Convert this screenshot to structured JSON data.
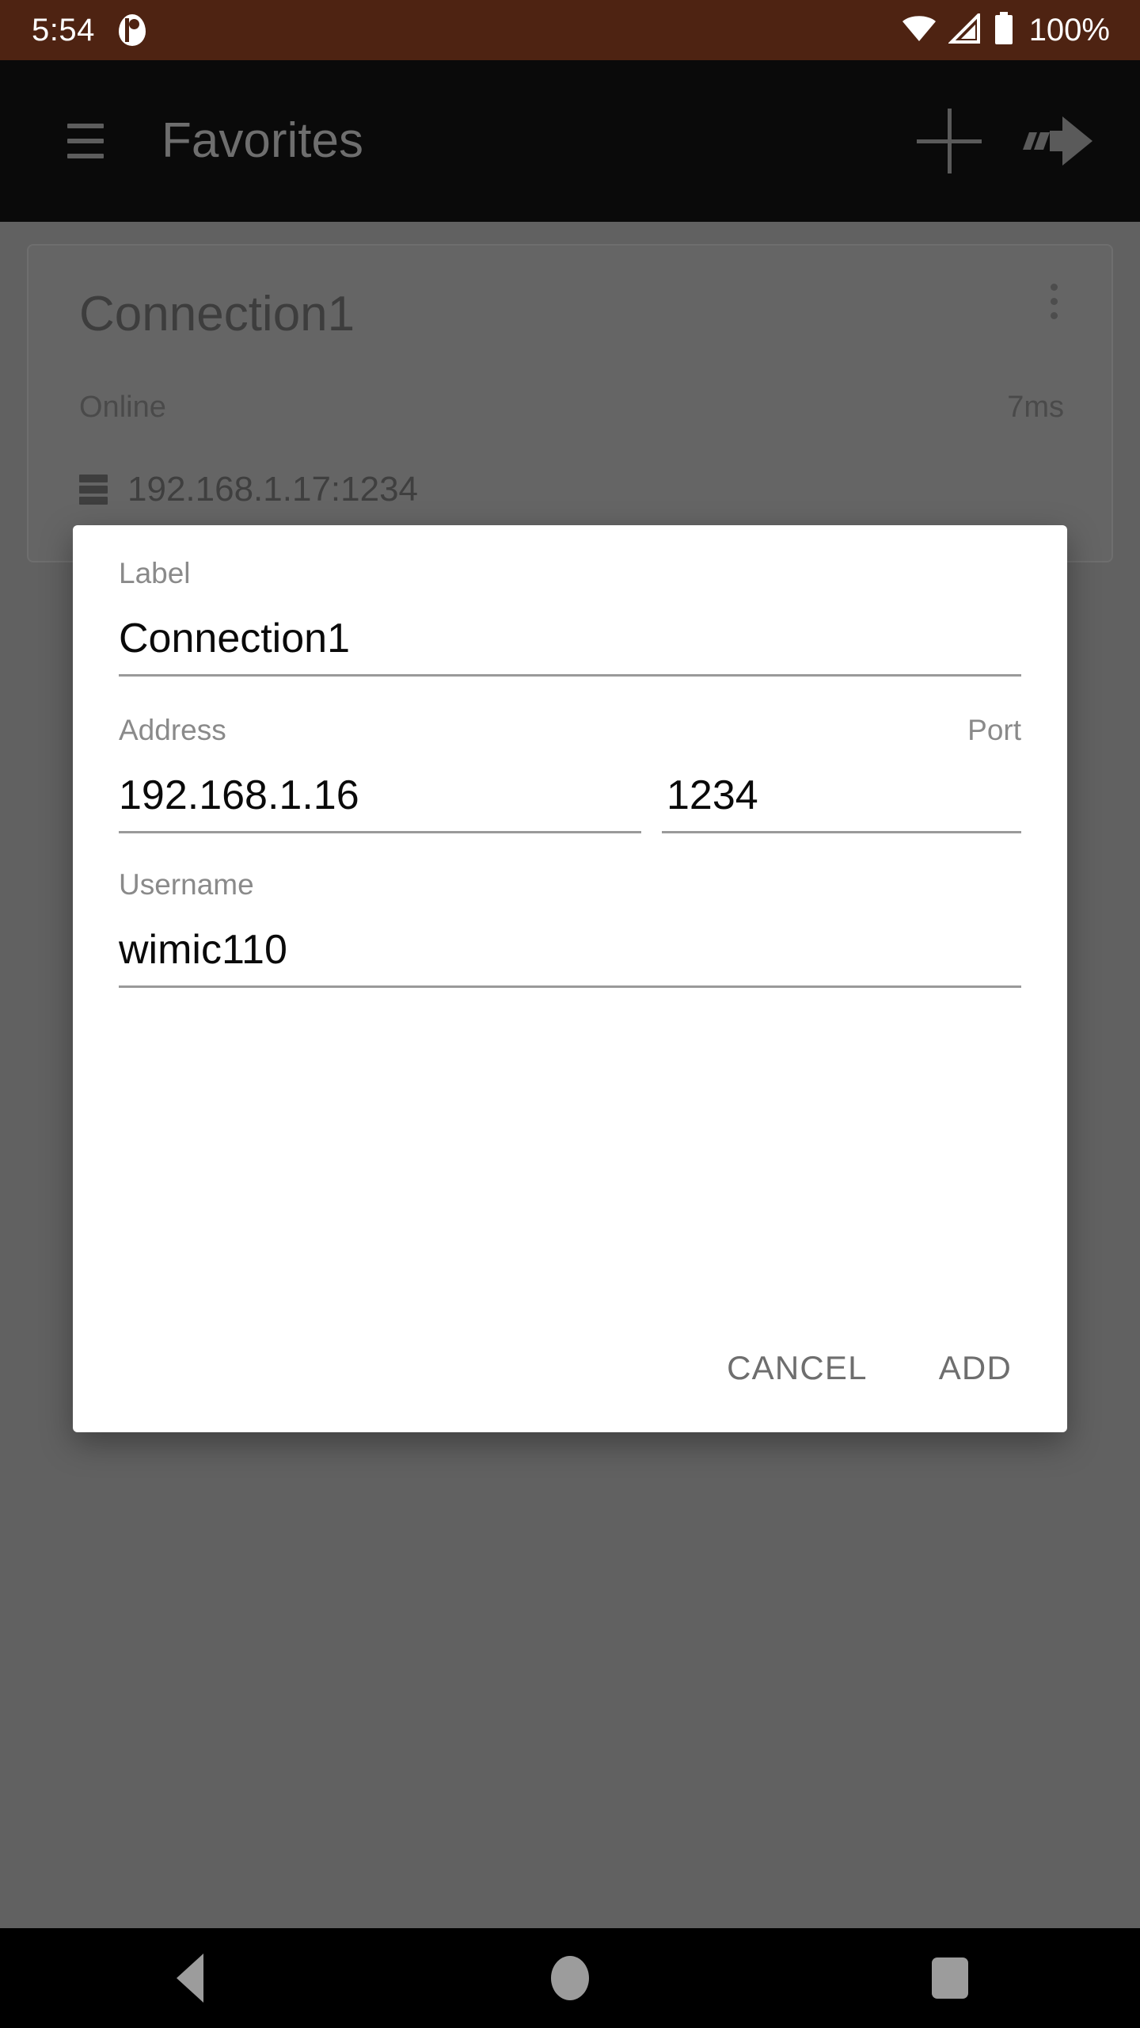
{
  "status_bar": {
    "clock": "5:54",
    "app_icon": "app-notification-icon",
    "wifi_icon": "wifi-icon",
    "cellular_icon": "cellular-signal-icon",
    "battery_icon": "battery-full-icon",
    "battery_text": "100%",
    "background_color": "#4E2312",
    "foreground_color": "#FFFFFF"
  },
  "app_bar": {
    "menu_icon": "hamburger-menu-icon",
    "title": "Favorites",
    "add_icon": "plus-icon",
    "forward_icon": "fast-forward-arrow-icon",
    "background_color": "#0A0A0A",
    "title_color": "#6E6E6E"
  },
  "connection_card": {
    "title": "Connection1",
    "status": "Online",
    "latency": "7ms",
    "address": "192.168.1.17:1234",
    "server_icon": "server-stack-icon",
    "overflow_icon": "more-vertical-icon"
  },
  "dialog": {
    "fields": [
      {
        "label": "Label",
        "value": "Connection1",
        "placeholder": "Label"
      },
      {
        "label": "Address",
        "value": "192.168.1.16",
        "placeholder": "Address"
      },
      {
        "label": "Port",
        "value": "1234",
        "placeholder": "Port"
      },
      {
        "label": "Username",
        "value": "wimic110",
        "placeholder": "Username"
      }
    ],
    "cancel_label": "CANCEL",
    "add_label": "ADD",
    "background_color": "#FFFFFF",
    "label_color": "#8A8A8A",
    "value_color": "#0A0A0A",
    "button_color": "#6E6E6E"
  },
  "nav_bar": {
    "back_icon": "nav-back-triangle-icon",
    "home_icon": "nav-home-circle-icon",
    "recents_icon": "nav-recents-square-icon",
    "icon_color": "#9C9C9C"
  },
  "scrim": {
    "color": "#616161"
  }
}
